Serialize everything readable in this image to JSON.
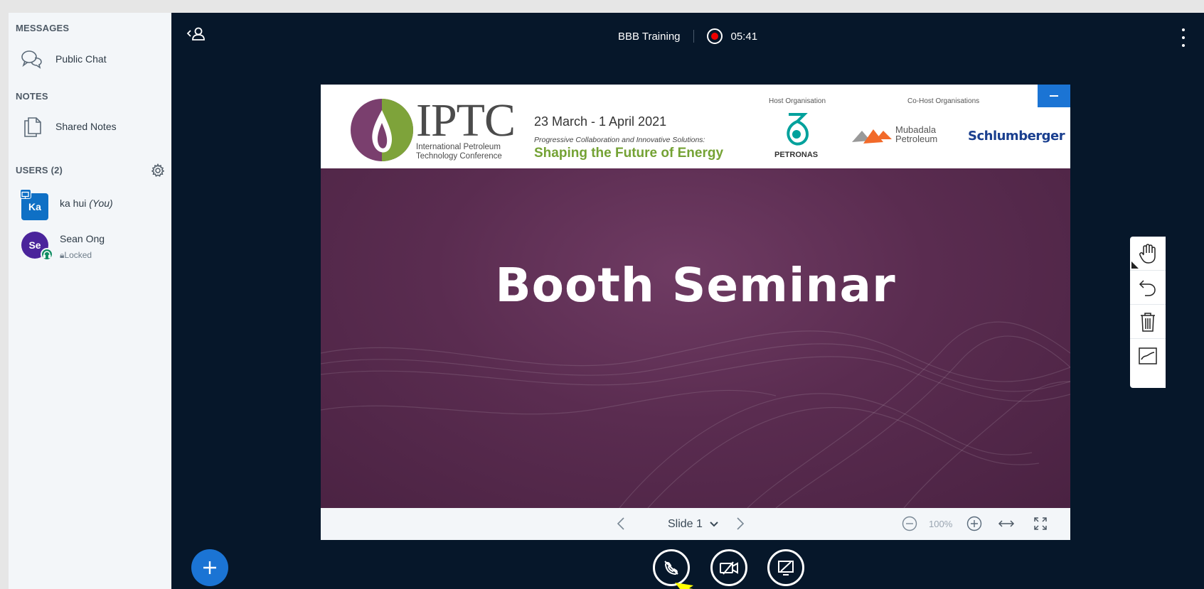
{
  "sidebar": {
    "messages_title": "MESSAGES",
    "public_chat_label": "Public Chat",
    "notes_title": "NOTES",
    "shared_notes_label": "Shared Notes",
    "users_title": "USERS (2)",
    "users": [
      {
        "initials": "Ka",
        "name": "ka hui",
        "you_suffix": "(You)",
        "status": ""
      },
      {
        "initials": "Se",
        "name": "Sean Ong",
        "you_suffix": "",
        "status": "Locked"
      }
    ]
  },
  "topbar": {
    "meeting_title": "BBB Training",
    "recording_time": "05:41"
  },
  "slide": {
    "logo_text": "IPTC",
    "logo_sub_1": "International Petroleum",
    "logo_sub_2": "Technology Conference",
    "dates": "23 March - 1 April 2021",
    "tagline": "Progressive Collaboration and Innovative Solutions:",
    "headline": "Shaping the Future of Energy",
    "host_label": "Host Organisation",
    "cohost_label": "Co-Host Organisations",
    "petronas": "PETRONAS",
    "mubadala_1": "Mubadala",
    "mubadala_2": "Petroleum",
    "schlumberger": "Schlumberger",
    "title": "Booth Seminar"
  },
  "controls": {
    "slide_selector": "Slide 1",
    "zoom": "100%"
  },
  "colors": {
    "main_bg": "#06172a",
    "sidebar_bg": "#f3f6f9",
    "accent": "#1b74d4",
    "slide_purple": "#5a2c50",
    "iptc_green": "#74a234"
  }
}
